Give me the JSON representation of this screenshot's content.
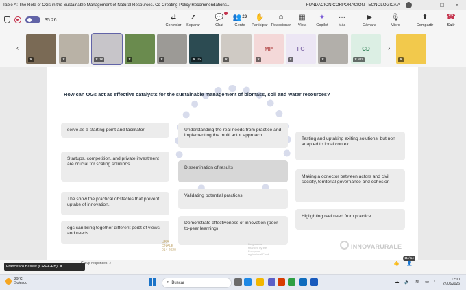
{
  "window": {
    "title": "Table A: The Role of OGs in the Sustainable Management of Natural Resources. Co-Creating Policy Recommendations...",
    "organization": "FUNDACION CORPORACION TECNOLOGICA A",
    "minimize_glyph": "—",
    "maximize_glyph": "☐",
    "close_glyph": "✕"
  },
  "toolbar": {
    "timer": "35:26",
    "buttons": [
      {
        "label": "Controlar",
        "icon": "control-icon",
        "glyph": "⇄"
      },
      {
        "label": "Separar",
        "icon": "detach-icon",
        "glyph": "↗"
      },
      {
        "label": "Chat",
        "icon": "chat-icon",
        "glyph": "💬"
      },
      {
        "label": "Gente",
        "icon": "people-icon",
        "glyph": "👥",
        "count": "23"
      },
      {
        "label": "Participar",
        "icon": "raise-hand-icon",
        "glyph": "✋"
      },
      {
        "label": "Reaccionar",
        "icon": "react-icon",
        "glyph": "☺"
      },
      {
        "label": "Vista",
        "icon": "view-icon",
        "glyph": "▦"
      },
      {
        "label": "Copilot",
        "icon": "copilot-icon",
        "glyph": "✦"
      },
      {
        "label": "Más",
        "icon": "more-icon",
        "glyph": "···"
      },
      {
        "label": "Cámara",
        "icon": "camera-icon",
        "glyph": "▶"
      },
      {
        "label": "Micro",
        "icon": "mic-off-icon",
        "glyph": "🎙"
      },
      {
        "label": "Compartir",
        "icon": "share-icon",
        "glyph": "⬆"
      },
      {
        "label": "Salir",
        "icon": "leave-icon",
        "glyph": "☎"
      }
    ]
  },
  "participants": [
    {
      "initials": "",
      "bg": "#7a6a55"
    },
    {
      "initials": "",
      "bg": "#b9b2a6"
    },
    {
      "initials": "",
      "bg": "#c7c5c9",
      "selected": true,
      "name": "ze"
    },
    {
      "initials": "",
      "bg": "#6a8b4e"
    },
    {
      "initials": "",
      "bg": "#9c9a96"
    },
    {
      "initials": "",
      "bg": "#2c4b52",
      "name": "JS"
    },
    {
      "initials": "",
      "bg": "#cfcac4"
    },
    {
      "initials": "MP",
      "bg": "#f4d8d8",
      "fg": "#b95656"
    },
    {
      "initials": "FG",
      "bg": "#ece6f4",
      "fg": "#8b76b0"
    },
    {
      "initials": "",
      "bg": "#b2afaa"
    },
    {
      "initials": "CD",
      "bg": "#dcefe4",
      "fg": "#3f8a63",
      "name": "era"
    },
    {
      "initials": "",
      "bg": "#f2c94c"
    }
  ],
  "slide": {
    "question": "How can OGs act as effective catalysts for the sustainable management of biomass, soil and water resources?",
    "cards": [
      {
        "text": "serve as a starting point and facilitator",
        "col": 0,
        "highlight": false
      },
      {
        "text": "Startups, competition, and private investment are crucial for scaling solutions.",
        "col": 0,
        "highlight": false
      },
      {
        "text": "The show the practical obstacles that prevent uptake of innovation.",
        "col": 0,
        "highlight": false
      },
      {
        "text": "ogs can bring together different poibt of views and needs",
        "col": 0,
        "highlight": false
      },
      {
        "text": "Understanding the real needs from practice and implementing the multi actor approach",
        "col": 1,
        "highlight": false
      },
      {
        "text": "Dissemination of results",
        "col": 1,
        "highlight": true
      },
      {
        "text": "Validating potential practices",
        "col": 1,
        "highlight": false
      },
      {
        "text": "Demonstrate effectiveness of innovation (peer-to-peer learning)",
        "col": 1,
        "highlight": false
      },
      {
        "text": "Testing and uptaking exiting solutions, but non adapted to local context.",
        "col": 2,
        "highlight": false
      },
      {
        "text": "Making a conector between actors and civil society, territorial governance and cohesion",
        "col": 2,
        "highlight": false
      },
      {
        "text": "Higlighting reel need from practice",
        "col": 2,
        "highlight": false
      }
    ],
    "logo": "INNOVARURALE",
    "footer_text_1": "URA\nONALE\n014 2020",
    "footer_text_2": "Programme financed by the European Agricultural Fund",
    "page_counter": "11 / 14"
  },
  "presenter": {
    "name": "Francesco Basset (CREA-PB)",
    "group_label": "Group responses"
  },
  "taskbar": {
    "weather_temp": "29°C",
    "weather_desc": "Soleado",
    "search_placeholder": "Buscar",
    "time": "12:00",
    "date": "27/05/2026"
  }
}
